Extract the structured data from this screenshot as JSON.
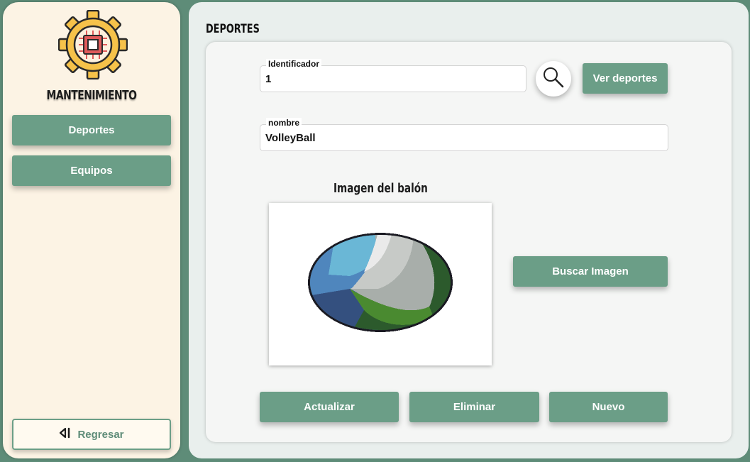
{
  "sidebar": {
    "logo_icon": "gear-chip-icon",
    "title": "MANTENIMIENTO",
    "items": [
      {
        "label": "Deportes"
      },
      {
        "label": "Equipos"
      }
    ],
    "back_label": "Regresar",
    "back_icon": "back-arrow-icon"
  },
  "main": {
    "title": "DEPORTES",
    "id_field": {
      "label": "Identificador",
      "value": "1"
    },
    "search_icon": "search-icon",
    "view_button": "Ver deportes",
    "name_field": {
      "label": "nombre",
      "value": "VolleyBall"
    },
    "image_title": "Imagen del balón",
    "search_image_button": "Buscar Imagen",
    "actions": {
      "update": "Actualizar",
      "delete": "Eliminar",
      "new": "Nuevo"
    }
  },
  "colors": {
    "background": "#5e8c78",
    "button": "#6b9e87",
    "sidebar": "#fcf3e4",
    "panel": "#e9efed",
    "card": "#f5f6f5"
  }
}
